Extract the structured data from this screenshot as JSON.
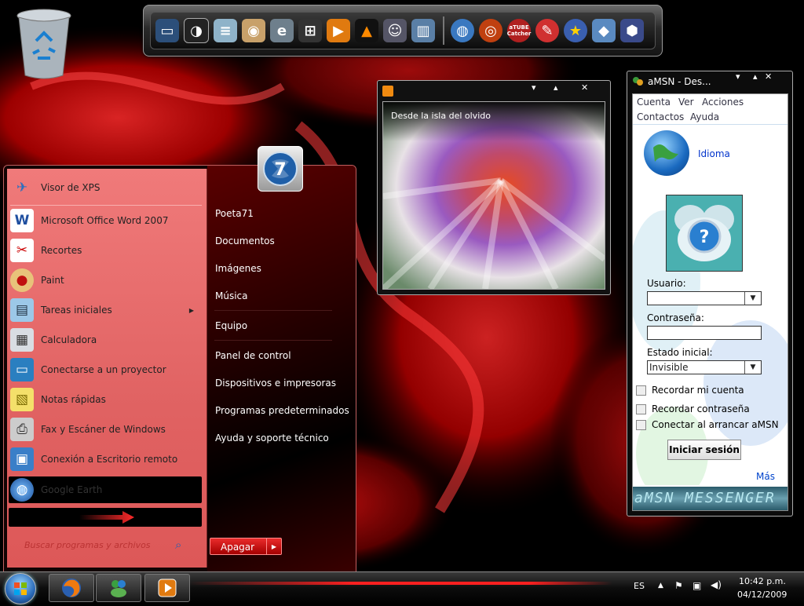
{
  "colors": {
    "accent_red": "#e02020",
    "start_menu_left": "#e86a6a",
    "amsn_link": "#0044cc"
  },
  "desktop": {
    "icons": [
      "recycle-bin-icon"
    ]
  },
  "dock": {
    "icons": [
      "monitor-icon",
      "control-panel-icon",
      "notepad-icon",
      "cd-icon",
      "ie-icon",
      "windows-icon",
      "media-player-icon",
      "vlc-icon",
      "users-icon",
      "book-icon",
      "globe-icon",
      "ring-icon",
      "atube-catcher-icon",
      "paint-icon",
      "star-icon",
      "virtualbox-icon",
      "network-icon"
    ],
    "atube_label": "aTUBE Catcher"
  },
  "start_menu": {
    "left_items": [
      {
        "label": "Visor de XPS",
        "icon": "xps-viewer-icon"
      },
      {
        "label": "Microsoft Office Word 2007",
        "icon": "word-icon"
      },
      {
        "label": "Recortes",
        "icon": "snipping-tool-icon"
      },
      {
        "label": "Paint",
        "icon": "paint-icon"
      },
      {
        "label": "Tareas iniciales",
        "icon": "getting-started-icon",
        "submenu": true
      },
      {
        "label": "Calculadora",
        "icon": "calculator-icon"
      },
      {
        "label": "Conectarse a un proyector",
        "icon": "projector-icon"
      },
      {
        "label": "Notas rápidas",
        "icon": "sticky-notes-icon"
      },
      {
        "label": "Fax y Escáner de Windows",
        "icon": "fax-scanner-icon"
      },
      {
        "label": "Conexión a Escritorio remoto",
        "icon": "remote-desktop-icon"
      },
      {
        "label": "Google Earth",
        "icon": "google-earth-icon"
      }
    ],
    "search_placeholder": "Buscar programas y archivos",
    "right_items": [
      "Poeta71",
      "Documentos",
      "Imágenes",
      "Música",
      "Equipo",
      "Panel de control",
      "Dispositivos e impresoras",
      "Programas predeterminados",
      "Ayuda y soporte técnico"
    ],
    "shutdown_label": "Apagar",
    "badge_text": "7"
  },
  "media_window": {
    "title": "Desde la isla del olvido",
    "controls": [
      "▾",
      "▴",
      "✕"
    ]
  },
  "amsn": {
    "title": "aMSN - Des...",
    "controls": [
      "▾",
      "▴",
      "✕"
    ],
    "menu": [
      "Cuenta",
      "Ver",
      "Acciones",
      "Contactos",
      "Ayuda"
    ],
    "language_link": "Idioma",
    "user_label": "Usuario:",
    "user_value": "",
    "password_label": "Contraseña:",
    "password_value": "",
    "status_label": "Estado inicial:",
    "status_value": "Invisible",
    "remember_account": "Recordar mi cuenta",
    "remember_password": "Recordar contraseña",
    "auto_connect": "Conectar al arrancar aMSN",
    "login_button": "Iniciar sesión",
    "more_link": "Más",
    "banner": "aMSN MESSENGER"
  },
  "taskbar": {
    "pinned": [
      "firefox-icon",
      "msn-icon",
      "media-player-icon"
    ],
    "language": "ES",
    "time": "10:42 p.m.",
    "date": "04/12/2009"
  }
}
